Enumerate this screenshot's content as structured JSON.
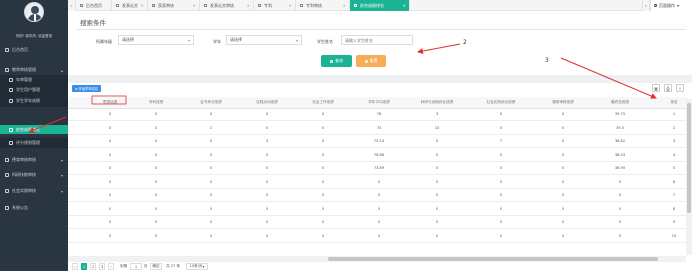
{
  "sidebar": {
    "welcome": "你好! 城市风, 欢迎登录",
    "items": [
      {
        "label": "后台首页"
      },
      {
        "label": "教师审核管理"
      },
      {
        "label": "年审管理"
      },
      {
        "label": "学生用户管理"
      },
      {
        "label": "学生学年成绩"
      },
      {
        "label": "综合成绩排名"
      },
      {
        "label": "评分规则管理"
      },
      {
        "label": "德育审核审核"
      },
      {
        "label": "科研技能审核"
      },
      {
        "label": "社会实践审核"
      },
      {
        "label": "系统公告"
      }
    ]
  },
  "tabs": [
    {
      "label": "后台首页"
    },
    {
      "label": "发表论文"
    },
    {
      "label": "获奖审核"
    },
    {
      "label": "发表论文审核"
    },
    {
      "label": "专利"
    },
    {
      "label": "专利审核"
    },
    {
      "label": "综合成绩排名"
    }
  ],
  "page_op": "页面操作",
  "search": {
    "title": "搜索条件",
    "fields": [
      {
        "label": "所属年级",
        "value": "请选择"
      },
      {
        "label": "学年",
        "value": "请选择"
      },
      {
        "label": "学生姓名",
        "placeholder": "请输入学生姓名"
      }
    ],
    "query_label": "查询",
    "reset_label": "重置"
  },
  "annotations": {
    "a2": "2",
    "a3": "3"
  },
  "toolbar": {
    "export_label": "开始学年成绩"
  },
  "table": {
    "columns": [
      "思想品德",
      "专利成绩",
      "证书考试成绩",
      "实践活动成绩",
      "社会工作成绩",
      "学年平均成绩",
      "科研与创新综合成绩",
      "社会实践综合成绩",
      "德育审核成绩",
      "最终总成绩",
      "排名"
    ],
    "rows": [
      [
        "0",
        "0",
        "0",
        "0",
        "0",
        "78",
        "3",
        "0",
        "0",
        "39.75",
        "1"
      ],
      [
        "0",
        "3",
        "2",
        "0",
        "0",
        "74",
        "10",
        "0",
        "0",
        "39.5",
        "2"
      ],
      [
        "0",
        "0",
        "0",
        "3",
        "4",
        "75.14",
        "0",
        "7",
        "0",
        "38.62",
        "3"
      ],
      [
        "0",
        "0",
        "0",
        "0",
        "0",
        "76.86",
        "0",
        "0",
        "0",
        "38.43",
        "4"
      ],
      [
        "0",
        "0",
        "0",
        "0",
        "0",
        "73.69",
        "0",
        "0",
        "0",
        "36.95",
        "5"
      ],
      [
        "0",
        "0",
        "0",
        "0",
        "0",
        "0",
        "0",
        "0",
        "0",
        "0",
        "6"
      ],
      [
        "0",
        "0",
        "0",
        "0",
        "0",
        "0",
        "0",
        "0",
        "0",
        "0",
        "7"
      ],
      [
        "0",
        "0",
        "0",
        "0",
        "0",
        "0",
        "0",
        "0",
        "0",
        "0",
        "8"
      ],
      [
        "0",
        "0",
        "0",
        "0",
        "0",
        "0",
        "0",
        "0",
        "0",
        "0",
        "9"
      ],
      [
        "0",
        "0",
        "0",
        "0",
        "0",
        "0",
        "0",
        "0",
        "0",
        "0",
        "10"
      ]
    ]
  },
  "pager": {
    "pages": [
      "1",
      "2",
      "3"
    ],
    "goto_label": "到第",
    "goto_value": "1",
    "page_unit": "页",
    "confirm": "确定",
    "total": "共 27 条",
    "per_page": "10条/页"
  },
  "colors": {
    "sidebar": "#2a3542",
    "accent": "#1ab394",
    "reset": "#f8ac59",
    "annotation": "#e03030"
  }
}
